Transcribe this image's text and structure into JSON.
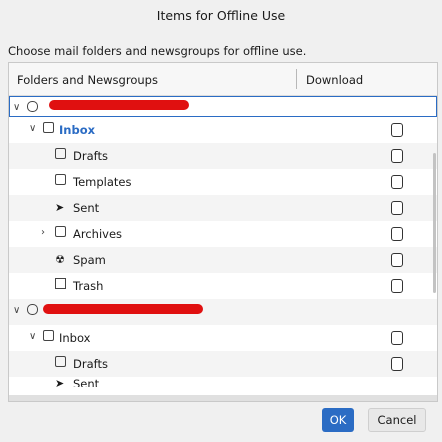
{
  "dialog": {
    "title": "Items for Offline Use",
    "description": "Choose mail folders and newsgroups for offline use."
  },
  "table": {
    "col_folders": "Folders and Newsgroups",
    "col_download": "Download",
    "rows": [
      {
        "label": "",
        "kind": "account",
        "redacted": true,
        "expanded": true
      },
      {
        "label": "Inbox",
        "kind": "folder",
        "expanded": true
      },
      {
        "label": "Drafts",
        "kind": "drafts"
      },
      {
        "label": "Templates",
        "kind": "templates"
      },
      {
        "label": "Sent",
        "kind": "sent"
      },
      {
        "label": "Archives",
        "kind": "archives",
        "expanded": false
      },
      {
        "label": "Spam",
        "kind": "spam"
      },
      {
        "label": "Trash",
        "kind": "trash"
      },
      {
        "label": "",
        "kind": "account",
        "redacted": true,
        "expanded": true
      },
      {
        "label": "Inbox",
        "kind": "folder",
        "expanded": true
      },
      {
        "label": "Drafts",
        "kind": "drafts"
      },
      {
        "label": "Sent",
        "kind": "sent"
      }
    ]
  },
  "buttons": {
    "ok": "OK",
    "cancel": "Cancel"
  },
  "colors": {
    "accent": "#2b6cc4",
    "redaction": "#e01010"
  },
  "icons": [
    "chevron-down-icon",
    "chevron-right-icon",
    "account-icon",
    "inbox-icon",
    "drafts-icon",
    "templates-icon",
    "sent-icon",
    "archives-icon",
    "spam-icon",
    "trash-icon",
    "checkbox"
  ]
}
